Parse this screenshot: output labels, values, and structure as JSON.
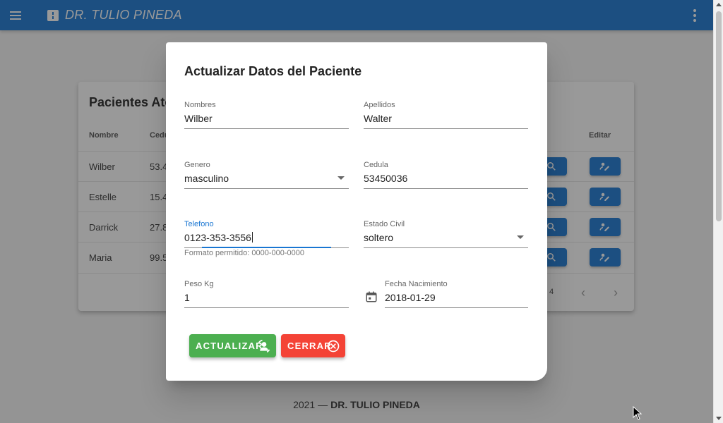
{
  "appbar": {
    "title": "DR. TULIO PINEDA"
  },
  "card": {
    "title": "Pacientes Atendidos",
    "columns": [
      "Nombre",
      "Cedula",
      "Editar"
    ],
    "rows": [
      {
        "name": "Wilber",
        "cedula": "53.4"
      },
      {
        "name": "Estelle",
        "cedula": "15.4"
      },
      {
        "name": "Darrick",
        "cedula": "27.8"
      },
      {
        "name": "Maria",
        "cedula": "99.5"
      }
    ],
    "pager": "4"
  },
  "dialog": {
    "title": "Actualizar Datos del Paciente",
    "fields": {
      "nombres": {
        "label": "Nombres",
        "value": "Wilber"
      },
      "apellidos": {
        "label": "Apellidos",
        "value": "Walter"
      },
      "genero": {
        "label": "Genero",
        "value": "masculino"
      },
      "cedula": {
        "label": "Cedula",
        "value": "53450036"
      },
      "telefono": {
        "label": "Telefono",
        "value": "0123-353-3556",
        "hint": "Formato permitido: 0000-000-0000"
      },
      "estado_civil": {
        "label": "Estado Civil",
        "value": "soltero"
      },
      "peso": {
        "label": "Peso Kg",
        "value": "1"
      },
      "fecha": {
        "label": "Fecha Nacimiento",
        "value": "2018-01-29"
      }
    },
    "buttons": {
      "update": "ACTUALIZAR",
      "close": "CERRAR"
    }
  },
  "footer": {
    "year": "2021 —",
    "name": "DR. TULIO PINEDA"
  },
  "colors": {
    "primary": "#1976d2",
    "success": "#4caf50",
    "error": "#f44336"
  }
}
